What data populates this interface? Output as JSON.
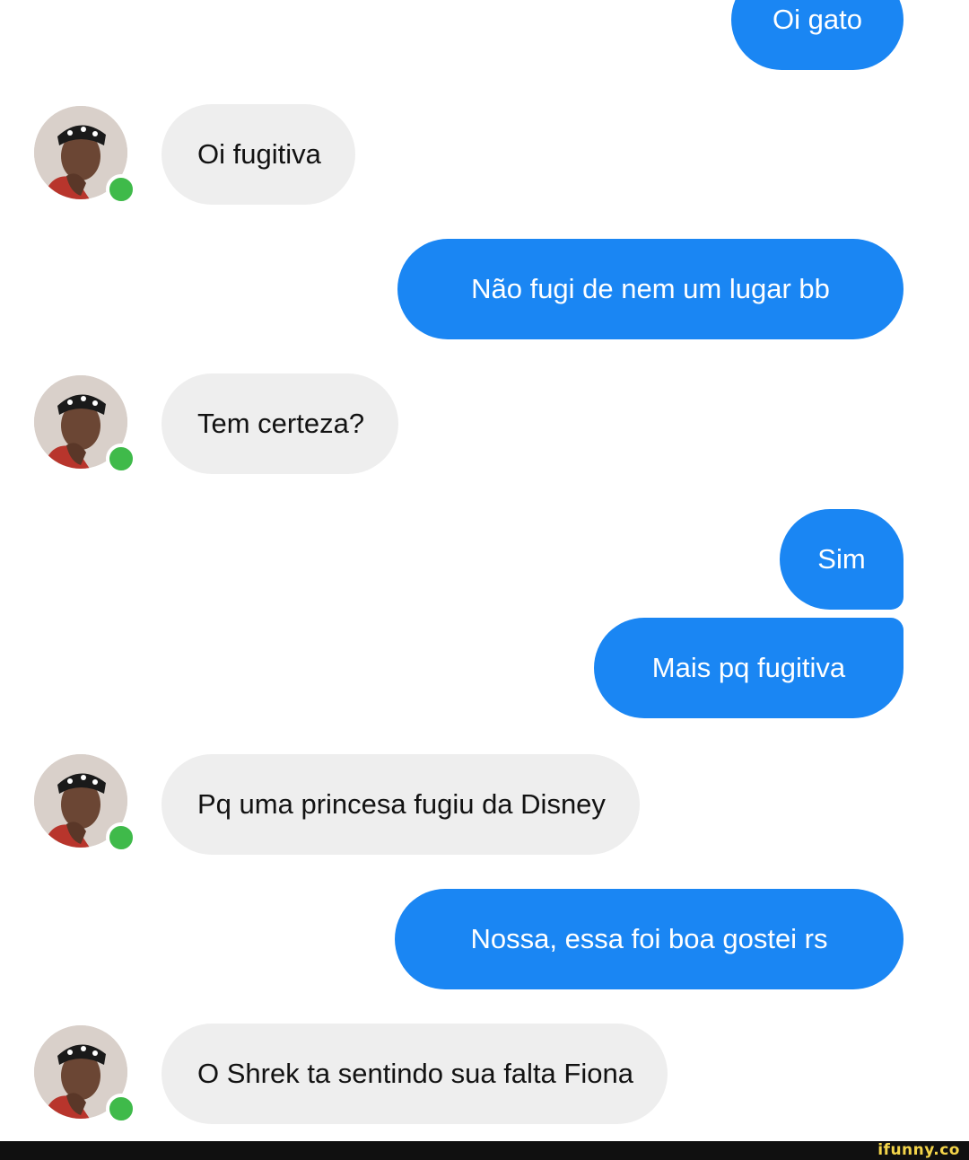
{
  "colors": {
    "sent_bubble": "#1a86f3",
    "received_bubble": "#eeeeee",
    "online_indicator": "#3fba4a",
    "watermark": "#f3d44a"
  },
  "contact": {
    "avatar_icon": "user-avatar-photo",
    "online_icon": "online-status-dot"
  },
  "messages": [
    {
      "direction": "sent",
      "text": "Oi gato"
    },
    {
      "direction": "received",
      "text": "Oi fugitiva"
    },
    {
      "direction": "sent",
      "text": "Não fugi de nem um lugar bb"
    },
    {
      "direction": "received",
      "text": "Tem certeza?"
    },
    {
      "direction": "sent",
      "text": "Sim"
    },
    {
      "direction": "sent",
      "text": "Mais pq fugitiva"
    },
    {
      "direction": "received",
      "text": "Pq uma princesa fugiu da Disney"
    },
    {
      "direction": "sent",
      "text": "Nossa, essa foi boa gostei rs"
    },
    {
      "direction": "received",
      "text": "O Shrek ta sentindo sua falta Fiona"
    }
  ],
  "watermark": {
    "text": "ifunny.co"
  }
}
